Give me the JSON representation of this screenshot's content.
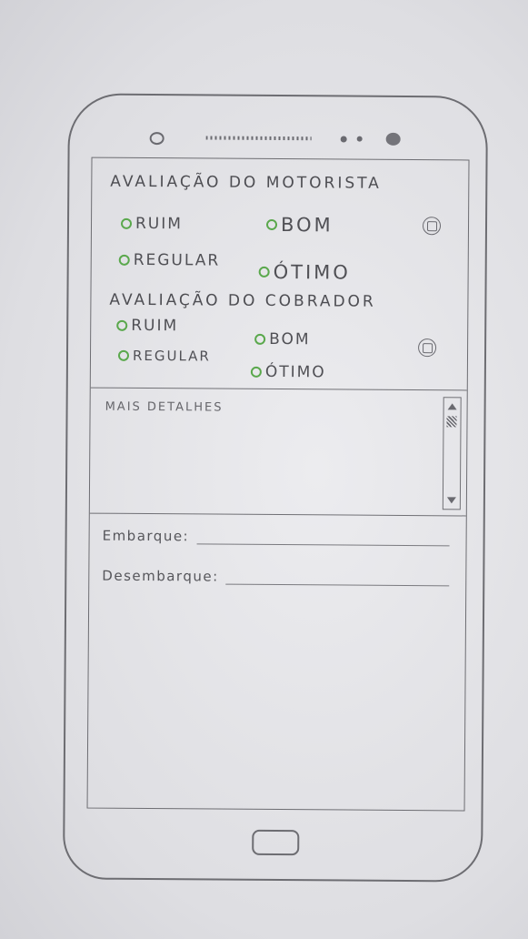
{
  "driver_rating": {
    "title": "Avaliação do Motorista",
    "options": [
      "Ruim",
      "Bom",
      "Regular",
      "Ótimo"
    ]
  },
  "collector_rating": {
    "title": "Avaliação do Cobrador",
    "options": [
      "Ruim",
      "Bom",
      "Regular",
      "Ótimo"
    ]
  },
  "details": {
    "label": "Mais Detalhes"
  },
  "trip": {
    "boarding_label": "Embarque:",
    "alighting_label": "Desembarque:"
  },
  "colors": {
    "radio": "#5aa84c",
    "pencil": "#6d6d72"
  }
}
